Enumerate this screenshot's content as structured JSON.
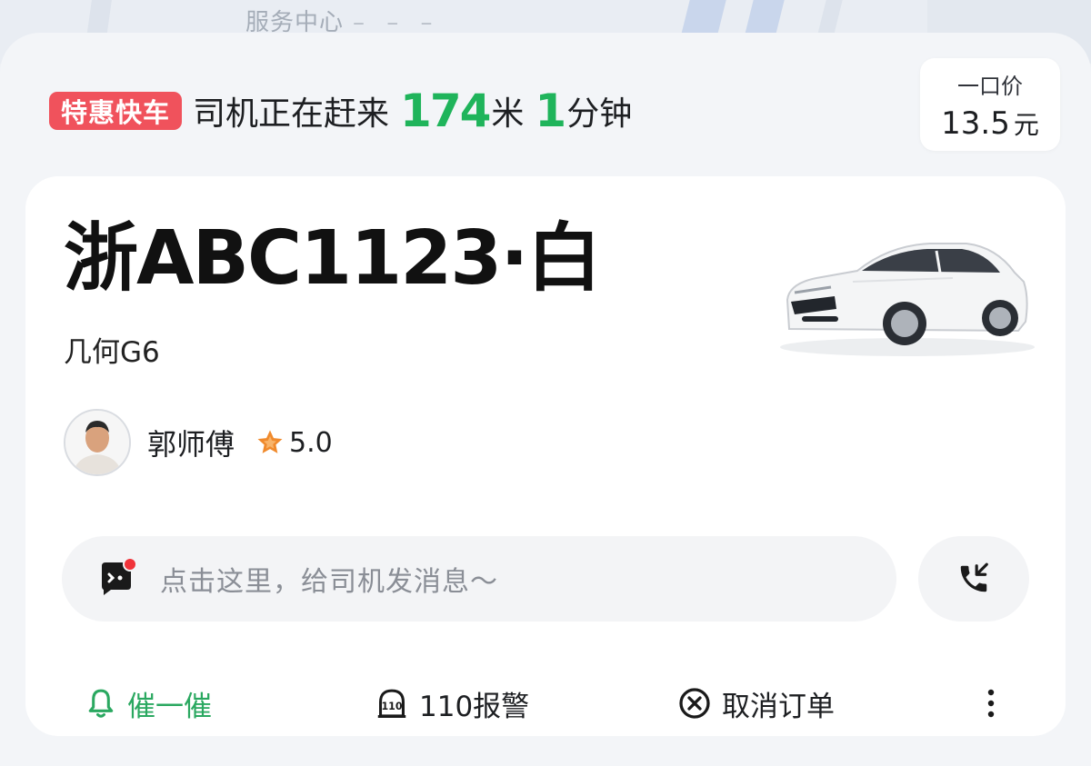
{
  "map": {
    "label": "服务中心",
    "label_dashes": "– – –"
  },
  "status": {
    "tag": "特惠快车",
    "text": "司机正在赶来",
    "distance_value": "174",
    "distance_unit": "米",
    "time_value": "1",
    "time_unit": "分钟"
  },
  "price": {
    "label": "一口价",
    "value": "13.5",
    "unit": "元"
  },
  "vehicle": {
    "plate": "浙ABC1123·白",
    "model": "几何G6"
  },
  "driver": {
    "name": "郭师傅",
    "rating": "5.0"
  },
  "message": {
    "placeholder": "点击这里，给司机发消息～",
    "unread": true
  },
  "actions": {
    "hurry": "催一催",
    "police": "110报警",
    "police_icon_text": "110",
    "cancel": "取消订单"
  },
  "colors": {
    "accent_green": "#1fb45b",
    "tag_red": "#f0525c",
    "badge_red": "#f0333a",
    "star_orange": "#f08a2c"
  }
}
